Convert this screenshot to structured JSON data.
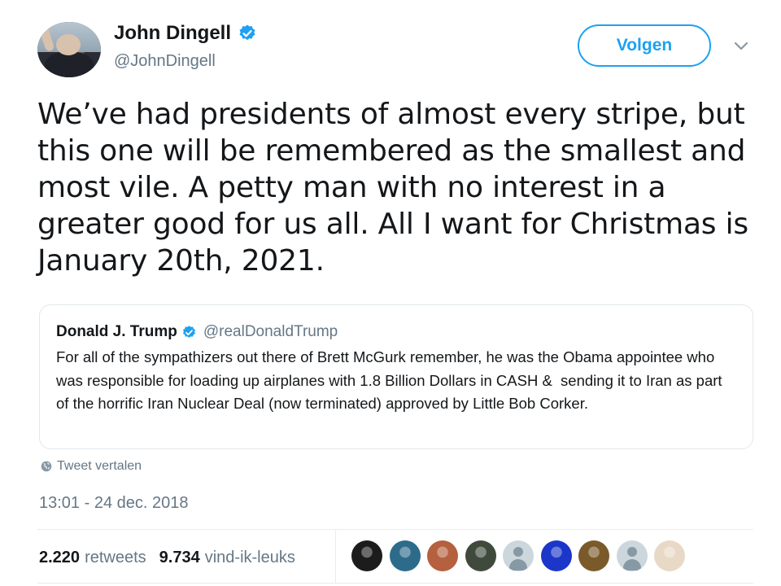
{
  "author": {
    "name": "John Dingell",
    "handle": "@JohnDingell"
  },
  "follow_label": "Volgen",
  "tweet_text": "We’ve had presidents of almost every stripe, but this one will be remembered as the smallest and most vile. A petty man with no interest in a greater good for us all. All I want for Christmas is January 20th, 2021.",
  "quoted_tweet": {
    "name": "Donald J. Trump",
    "handle": "@realDonaldTrump",
    "text": "For all of the sympathizers out there of Brett McGurk remember, he was the Obama appointee who was responsible for loading up airplanes with 1.8 Billion Dollars in CASH &  sending it to Iran as part of the horrific Iran Nuclear Deal (now terminated) approved by Little Bob Corker."
  },
  "translate_label": "Tweet vertalen",
  "timestamp": "13:01 - 24 dec. 2018",
  "stats": {
    "retweets_count": "2.220",
    "retweets_label": "retweets",
    "likes_count": "9.734",
    "likes_label": "vind-ik-leuks"
  },
  "colors": {
    "accent": "#1da1f2",
    "secondary_text": "#657786",
    "border": "#e1e8ed"
  },
  "likers": [
    {
      "icon": "liker-avatar-1",
      "color": "#1c1c1c"
    },
    {
      "icon": "liker-avatar-2",
      "color": "#2d6b8a"
    },
    {
      "icon": "liker-avatar-3",
      "color": "#b5603f"
    },
    {
      "icon": "liker-avatar-4",
      "color": "#3f4a3c"
    },
    {
      "icon": "liker-avatar-default",
      "color": "#ccd6dd"
    },
    {
      "icon": "liker-avatar-6",
      "color": "#1b36c9"
    },
    {
      "icon": "liker-avatar-7",
      "color": "#7a5a2a"
    },
    {
      "icon": "liker-avatar-default",
      "color": "#ccd6dd"
    },
    {
      "icon": "liker-avatar-9",
      "color": "#e8d9c6"
    }
  ]
}
